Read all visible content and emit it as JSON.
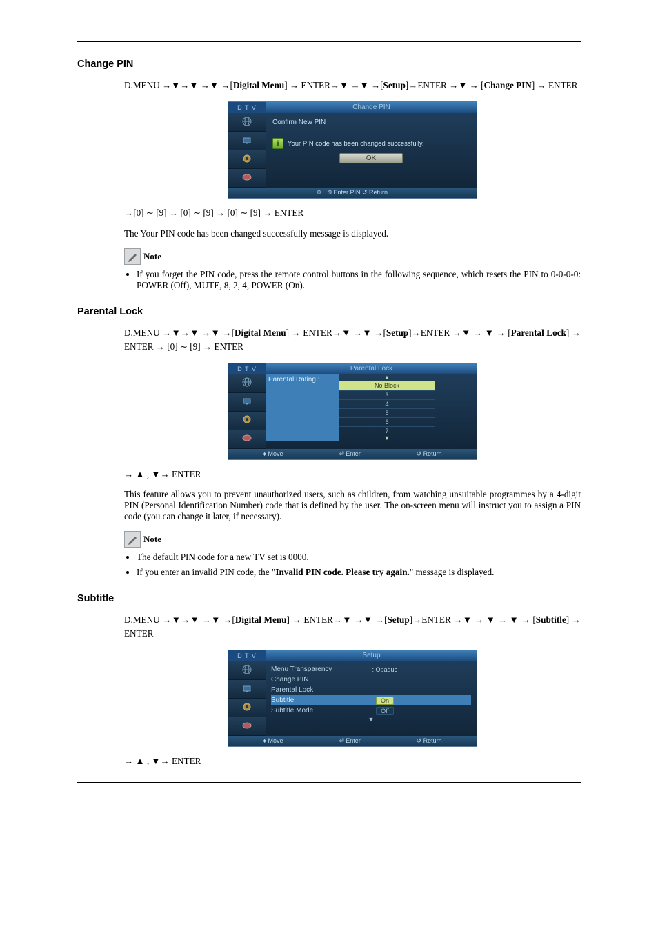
{
  "sec1": {
    "heading": "Change PIN",
    "path_html": "D.MENU →▼→▼ →▼ →[<b>Digital Menu</b>] → ENTER→▼ →▼ →[<b>Setup</b>]→ENTER →▼ → [<b>Change PIN</b>] → ENTER",
    "dialog": {
      "brand": "D T V",
      "title": "Change PIN",
      "confirm": "Confirm New PIN",
      "info": "Your PIN code has been changed successfully.",
      "ok": "OK",
      "foot": "0 ‥ 9 Enter PIN   ↺ Return"
    },
    "after": "→[0] ∼ [9] → [0] ∼ [9] → [0] ∼ [9] → ENTER",
    "msg": "The Your PIN code has been changed successfully message is displayed.",
    "note_label": "Note",
    "bullet": "If you forget the PIN code, press the remote control buttons in the following sequence, which resets the PIN to 0-0-0-0: POWER (Off), MUTE, 8, 2, 4, POWER (On)."
  },
  "sec2": {
    "heading": "Parental Lock",
    "path_html": "D.MENU →▼→▼ →▼ →[<b>Digital Menu</b>] → ENTER→▼ →▼ →[<b>Setup</b>]→ENTER →▼ → ▼ → [<b>Parental Lock</b>] → ENTER → [0] ∼ [9] → ENTER",
    "dialog": {
      "brand": "D T V",
      "title": "Parental Lock",
      "label": "Parental Rating :",
      "opts": [
        "No Block",
        "3",
        "4",
        "5",
        "6",
        "7"
      ],
      "foot": {
        "move": "♦ Move",
        "enter": "⏎ Enter",
        "return": "↺ Return"
      }
    },
    "after": "→ ▲ , ▼→ ENTER",
    "para": "This feature allows you to prevent unauthorized users, such as children, from watching unsuitable programmes by a 4-digit PIN (Personal Identification Number) code that is defined by the user. The on-screen menu will instruct you to assign a PIN code (you can change it later, if necessary).",
    "note_label": "Note",
    "b1": "The default PIN code for a new TV set is 0000.",
    "b2_html": "If you enter an invalid PIN code, the \"<b>Invalid PIN code. Please try again.</b>\" message is displayed."
  },
  "sec3": {
    "heading": "Subtitle",
    "path_html": "D.MENU →▼→▼ →▼ →[<b>Digital Menu</b>] → ENTER→▼ →▼ →[<b>Setup</b>]→ENTER →▼ → ▼ → ▼ → [<b>Subtitle</b>] → ENTER",
    "dialog": {
      "brand": "D T V",
      "title": "Setup",
      "rows": [
        {
          "lbl": "Menu Transparency",
          "val": ": Opaque",
          "plain": true
        },
        {
          "lbl": "Change PIN",
          "val": "",
          "plain": true
        },
        {
          "lbl": "Parental Lock",
          "val": "",
          "plain": true
        },
        {
          "lbl": "Subtitle",
          "val": "On",
          "plain": false,
          "hl": true,
          "sel": true
        },
        {
          "lbl": "Subtitle Mode",
          "val": "Off",
          "plain": false
        }
      ],
      "foot": {
        "move": "♦ Move",
        "enter": "⏎ Enter",
        "return": "↺ Return"
      }
    },
    "after": "→ ▲ , ▼→ ENTER"
  }
}
